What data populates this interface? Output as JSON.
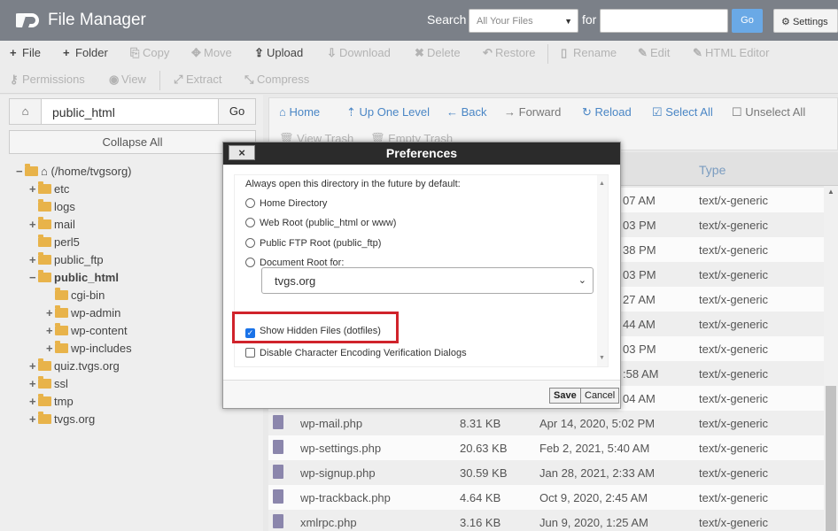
{
  "header": {
    "app_title": "File Manager",
    "search_label": "Search",
    "search_scope": "All Your Files",
    "for_label": "for",
    "search_value": "",
    "go_label": "Go",
    "settings_label": "Settings"
  },
  "toolbar": {
    "row1": [
      {
        "icon": "plus-icon",
        "glyph": "+",
        "label": "File",
        "enabled": true
      },
      {
        "icon": "plus-icon",
        "glyph": "+",
        "label": "Folder",
        "enabled": true
      },
      {
        "icon": "copy-icon",
        "glyph": "⎘",
        "label": "Copy",
        "enabled": false
      },
      {
        "icon": "move-icon",
        "glyph": "✥",
        "label": "Move",
        "enabled": false
      },
      {
        "icon": "upload-icon",
        "glyph": "⇪",
        "label": "Upload",
        "enabled": true
      },
      {
        "icon": "download-icon",
        "glyph": "⇩",
        "label": "Download",
        "enabled": false
      },
      {
        "icon": "delete-icon",
        "glyph": "✖",
        "label": "Delete",
        "enabled": false
      },
      {
        "icon": "restore-icon",
        "glyph": "↶",
        "label": "Restore",
        "enabled": false
      },
      {
        "icon": "rename-icon",
        "glyph": "▯",
        "label": "Rename",
        "enabled": false
      },
      {
        "icon": "edit-icon",
        "glyph": "✎",
        "label": "Edit",
        "enabled": false
      },
      {
        "icon": "html-editor-icon",
        "glyph": "✎",
        "label": "HTML Editor",
        "enabled": false
      }
    ],
    "row2": [
      {
        "icon": "key-icon",
        "glyph": "⚷",
        "label": "Permissions",
        "enabled": false
      },
      {
        "icon": "eye-icon",
        "glyph": "◉",
        "label": "View",
        "enabled": false
      },
      {
        "icon": "extract-icon",
        "glyph": "⤢",
        "label": "Extract",
        "enabled": false
      },
      {
        "icon": "compress-icon",
        "glyph": "⤡",
        "label": "Compress",
        "enabled": false
      }
    ]
  },
  "left": {
    "path_value": "public_html",
    "go_label": "Go",
    "collapse_label": "Collapse All",
    "tree": [
      {
        "toggle": "−",
        "label": "(/home/tvgsorg)",
        "root": true
      },
      {
        "toggle": "+",
        "label": "etc"
      },
      {
        "toggle": "",
        "label": "logs"
      },
      {
        "toggle": "+",
        "label": "mail"
      },
      {
        "toggle": "",
        "label": "perl5"
      },
      {
        "toggle": "+",
        "label": "public_ftp"
      },
      {
        "toggle": "−",
        "label": "public_html",
        "bold": true
      },
      {
        "toggle": "",
        "label": "cgi-bin"
      },
      {
        "toggle": "+",
        "label": "wp-admin"
      },
      {
        "toggle": "+",
        "label": "wp-content"
      },
      {
        "toggle": "+",
        "label": "wp-includes"
      },
      {
        "toggle": "+",
        "label": "quiz.tvgs.org"
      },
      {
        "toggle": "+",
        "label": "ssl"
      },
      {
        "toggle": "+",
        "label": "tmp"
      },
      {
        "toggle": "+",
        "label": "tvgs.org"
      }
    ]
  },
  "nav": {
    "home": "Home",
    "up": "Up One Level",
    "back": "Back",
    "forward": "Forward",
    "reload": "Reload",
    "select_all": "Select All",
    "unselect_all": "Unselect All",
    "view_trash": "View Trash",
    "empty_trash": "Empty Trash"
  },
  "table": {
    "type_header": "Type",
    "partial_rows": [
      {
        "time_tail": "07 AM",
        "type": "text/x-generic"
      },
      {
        "time_tail": "03 PM",
        "type": "text/x-generic"
      },
      {
        "time_tail": "38 PM",
        "type": "text/x-generic"
      },
      {
        "time_tail": "03 PM",
        "type": "text/x-generic"
      },
      {
        "time_tail": "27 AM",
        "type": "text/x-generic"
      },
      {
        "time_tail": "44 AM",
        "type": "text/x-generic"
      },
      {
        "time_tail": "03 PM",
        "type": "text/x-generic"
      },
      {
        "time_tail": ":58 AM",
        "type": "text/x-generic"
      },
      {
        "time_tail": "04 AM",
        "type": "text/x-generic"
      }
    ],
    "rows": [
      {
        "name": "wp-mail.php",
        "size": "8.31 KB",
        "modified": "Apr 14, 2020, 5:02 PM",
        "type": "text/x-generic"
      },
      {
        "name": "wp-settings.php",
        "size": "20.63 KB",
        "modified": "Feb 2, 2021, 5:40 AM",
        "type": "text/x-generic"
      },
      {
        "name": "wp-signup.php",
        "size": "30.59 KB",
        "modified": "Jan 28, 2021, 2:33 AM",
        "type": "text/x-generic"
      },
      {
        "name": "wp-trackback.php",
        "size": "4.64 KB",
        "modified": "Oct 9, 2020, 2:45 AM",
        "type": "text/x-generic"
      },
      {
        "name": "xmlrpc.php",
        "size": "3.16 KB",
        "modified": "Jun 9, 2020, 1:25 AM",
        "type": "text/x-generic"
      }
    ]
  },
  "modal": {
    "title": "Preferences",
    "close_glyph": "×",
    "intro": "Always open this directory in the future by default:",
    "options": [
      {
        "label": "Home Directory"
      },
      {
        "label": "Web Root (public_html or www)"
      },
      {
        "label": "Public FTP Root (public_ftp)"
      },
      {
        "label": "Document Root for:"
      }
    ],
    "domain_value": "tvgs.org",
    "show_hidden_label": "Show Hidden Files (dotfiles)",
    "show_hidden_checked": true,
    "disable_encoding_label": "Disable Character Encoding Verification Dialogs",
    "disable_encoding_checked": false,
    "save_label": "Save",
    "cancel_label": "Cancel"
  },
  "colors": {
    "topbar": "#7b8088",
    "link_blue": "#4a86c5",
    "highlight_red": "#d0232b",
    "folder": "#e8b34a"
  }
}
